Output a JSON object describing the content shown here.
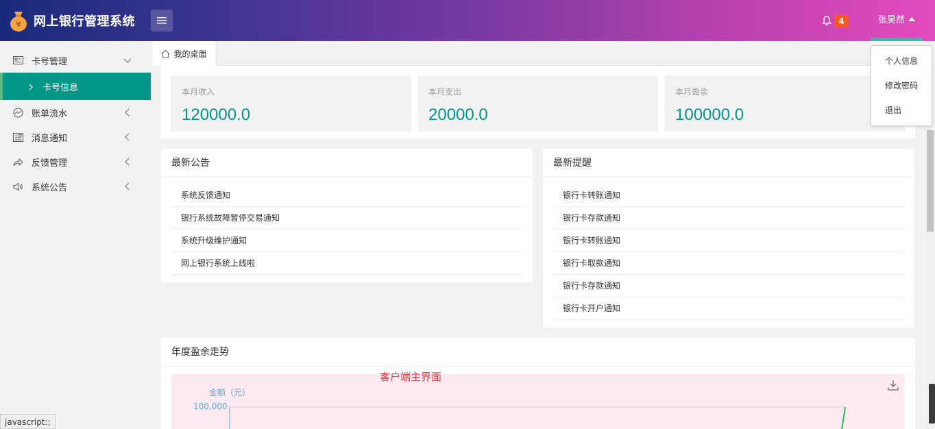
{
  "app": {
    "title": "网上银行管理系统",
    "notification_count": "4",
    "user_name": "张昊然"
  },
  "colors": {
    "accent": "#009688",
    "badge": "#ff5722",
    "header_gradient_start": "#1b2a7a",
    "header_gradient_end": "#e24bbd"
  },
  "sidebar": {
    "items": [
      {
        "label": "卡号管理",
        "icon": "id-card-icon",
        "expanded": true
      },
      {
        "label": "账单流水",
        "icon": "trend-icon"
      },
      {
        "label": "消息通知",
        "icon": "message-icon"
      },
      {
        "label": "反馈管理",
        "icon": "share-icon"
      },
      {
        "label": "系统公告",
        "icon": "speaker-icon"
      }
    ],
    "sub_items": [
      {
        "label": "卡号信息",
        "active": true
      }
    ]
  },
  "tabs": [
    {
      "label": "我的桌面",
      "icon": "home-icon",
      "active": true
    }
  ],
  "stats": [
    {
      "label": "本月收入",
      "value": "120000.0"
    },
    {
      "label": "本月支出",
      "value": "20000.0"
    },
    {
      "label": "本月盈余",
      "value": "100000.0"
    }
  ],
  "notices": {
    "title": "最新公告",
    "items": [
      "系统反馈通知",
      "银行系统故障暂停交易通知",
      "系统升级维护通知",
      "网上银行系统上线啦"
    ]
  },
  "reminders": {
    "title": "最新提醒",
    "items": [
      "银行卡转账通知",
      "银行卡存款通知",
      "银行卡转账通知",
      "银行卡取款通知",
      "银行卡存款通知",
      "银行卡开户通知"
    ]
  },
  "trend": {
    "title": "年度盈余走势"
  },
  "chart_data": {
    "type": "line",
    "title": "客户端主界面",
    "ylabel": "金额（元）",
    "y_ticks": [
      "100,000"
    ],
    "ylim_top": 100000,
    "colors": [
      "#22c55e"
    ]
  },
  "user_menu": {
    "items": [
      "个人信息",
      "修改密码",
      "退出"
    ]
  },
  "statusbar": {
    "text": "javascript:;"
  }
}
